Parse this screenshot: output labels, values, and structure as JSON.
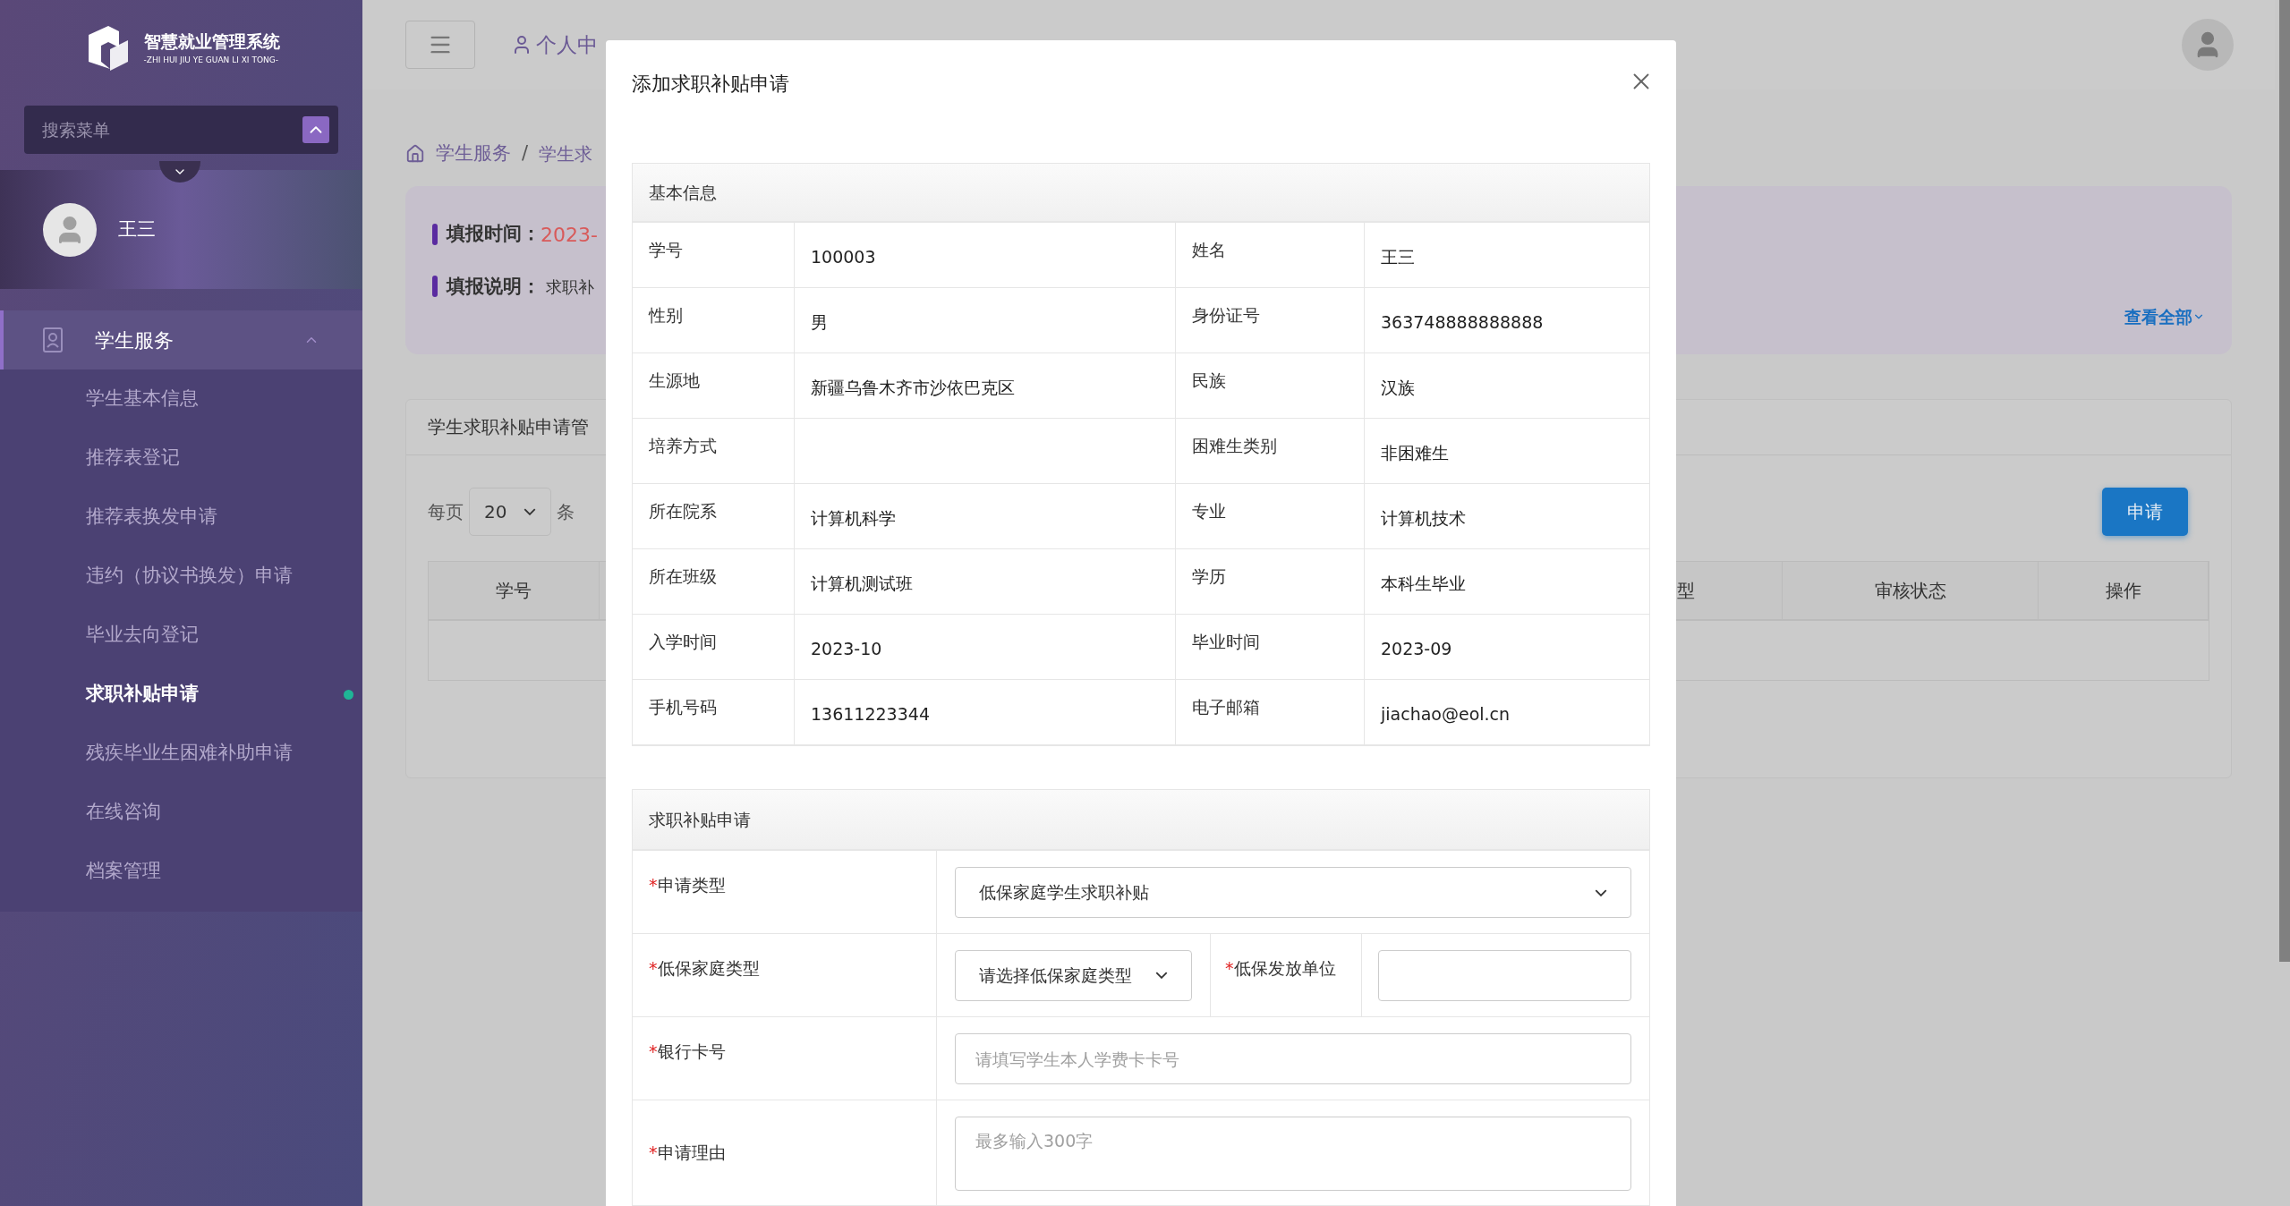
{
  "sidebar": {
    "logo_title": "智慧就业管理系统",
    "logo_subtitle": "-ZHI HUI JIU YE GUAN LI XI TONG-",
    "search": {
      "placeholder": "搜索菜单"
    },
    "user": {
      "name": "王三"
    },
    "profile_expanded": false,
    "menu": [
      {
        "label": "学生服务",
        "expanded": true,
        "children": [
          {
            "label": "学生基本信息",
            "selected": false
          },
          {
            "label": "推荐表登记",
            "selected": false
          },
          {
            "label": "推荐表换发申请",
            "selected": false
          },
          {
            "label": "违约（协议书换发）申请",
            "selected": false
          },
          {
            "label": "毕业去向登记",
            "selected": false
          },
          {
            "label": "求职补贴申请",
            "selected": true
          },
          {
            "label": "残疾毕业生困难补助申请",
            "selected": false
          },
          {
            "label": "在线咨询",
            "selected": false
          },
          {
            "label": "档案管理",
            "selected": false
          }
        ]
      }
    ]
  },
  "top_nav": {
    "tabs": [
      {
        "label": "个人中"
      }
    ]
  },
  "breadcrumb": {
    "items": [
      "学生服务",
      "学生求"
    ],
    "separator": "/"
  },
  "notice": {
    "items": [
      {
        "label": "填报时间：",
        "value": "2023-",
        "kind": "date"
      },
      {
        "label": "填报说明：",
        "value": "求职补",
        "kind": "text"
      }
    ],
    "more_link": "查看全部"
  },
  "list_panel": {
    "title": "学生求职补贴申请管",
    "page_size": {
      "prefix": "每页",
      "value": "20",
      "suffix": "条"
    },
    "apply_button": "申请",
    "table": {
      "columns": [
        {
          "label": "学号"
        },
        {
          "label": "型"
        },
        {
          "label": "审核状态"
        },
        {
          "label": "操作"
        }
      ]
    }
  },
  "dialog": {
    "title": "添加求职补贴申请",
    "basic_info": {
      "title": "基本信息",
      "rows": [
        [
          {
            "label": "学号",
            "value": "100003"
          },
          {
            "label": "姓名",
            "value": "王三"
          }
        ],
        [
          {
            "label": "性别",
            "value": "男"
          },
          {
            "label": "身份证号",
            "value": "363748888888888"
          }
        ],
        [
          {
            "label": "生源地",
            "value": "新疆乌鲁木齐市沙依巴克区"
          },
          {
            "label": "民族",
            "value": "汉族"
          }
        ],
        [
          {
            "label": "培养方式"
          },
          {
            "label": "困难生类别",
            "value": "非困难生"
          }
        ],
        [
          {
            "label": "所在院系",
            "value": "计算机科学"
          },
          {
            "label": "专业",
            "value": "计算机技术"
          }
        ],
        [
          {
            "label": "所在班级",
            "value": "计算机测试班"
          },
          {
            "label": "学历",
            "value": "本科生毕业"
          }
        ],
        [
          {
            "label": "入学时间",
            "value": "2023-10"
          },
          {
            "label": "毕业时间",
            "value": "2023-09"
          }
        ],
        [
          {
            "label": "手机号码",
            "value": "13611223344"
          },
          {
            "label": "电子邮箱",
            "value": "jiachao@eol.cn"
          }
        ]
      ]
    },
    "application": {
      "title": "求职补贴申请",
      "rows": [
        {
          "kind": "select",
          "mark": "*",
          "label": "申请类型",
          "value": "低保家庭学生求职补贴"
        },
        {
          "kind": "pair",
          "mark": "*",
          "label": "低保家庭类型",
          "value": "请选择低保家庭类型",
          "second_mark": "*",
          "second_label": "低保发放单位"
        },
        {
          "kind": "input",
          "mark": "*",
          "label": "银行卡号",
          "placeholder": "请填写学生本人学费卡卡号"
        },
        {
          "kind": "textarea",
          "mark": "*",
          "label": "申请理由",
          "placeholder": "最多输入300字"
        }
      ]
    }
  }
}
